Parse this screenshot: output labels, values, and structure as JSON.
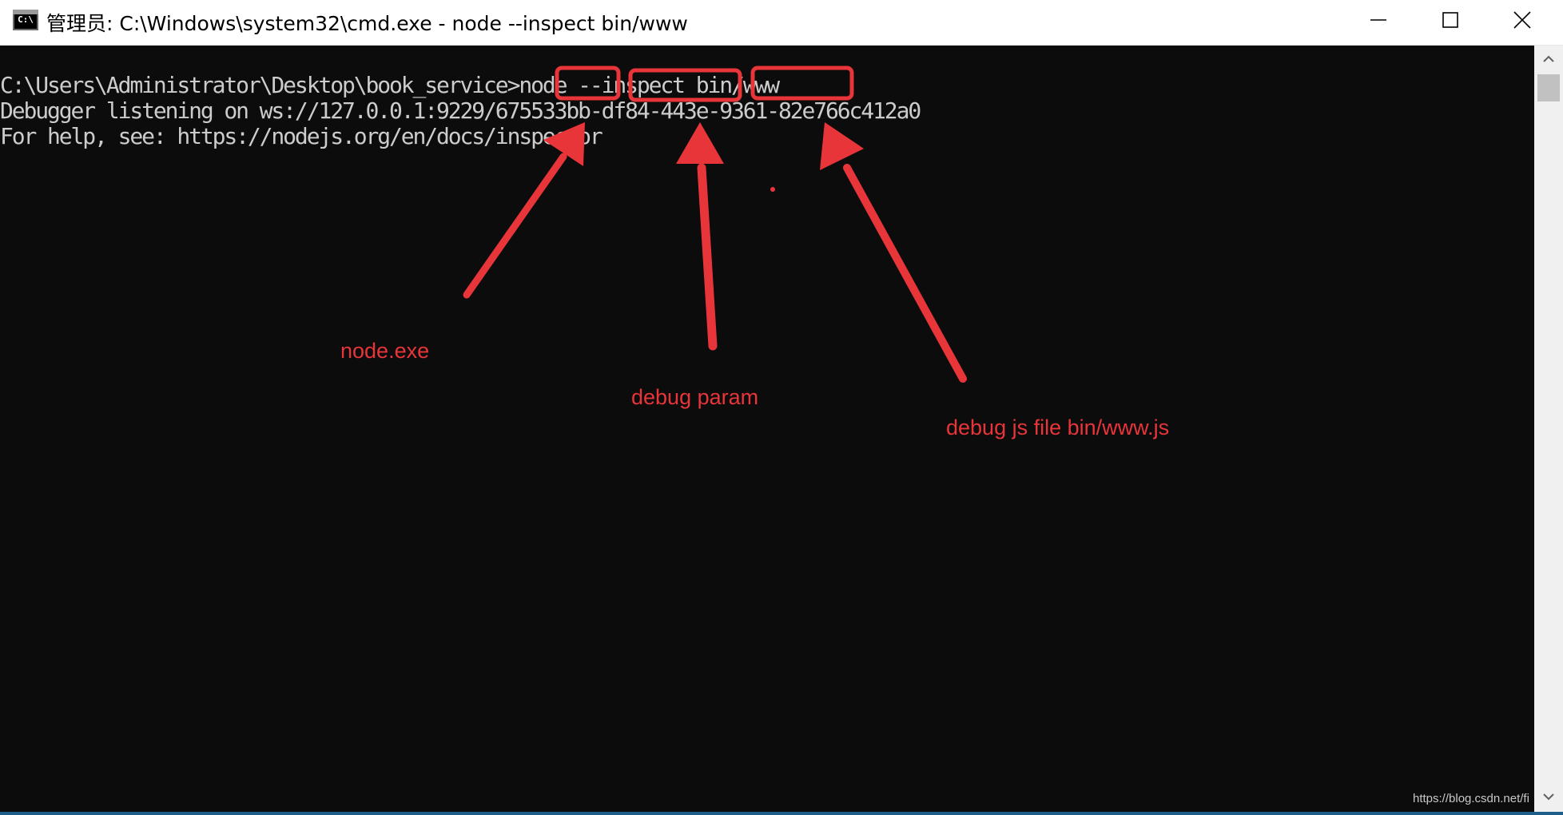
{
  "window": {
    "title": "管理员: C:\\Windows\\system32\\cmd.exe - node  --inspect bin/www",
    "icon": "cmd-icon",
    "icon_text": "C:\\",
    "controls": {
      "minimize": "minimize-icon",
      "maximize": "maximize-icon",
      "close": "close-icon"
    }
  },
  "terminal": {
    "lines": [
      "C:\\Users\\Administrator\\Desktop\\book_service>node --inspect bin/www",
      "Debugger listening on ws://127.0.0.1:9229/675533bb-df84-443e-9361-82e766c412a0",
      "For help, see: https://nodejs.org/en/docs/inspector"
    ],
    "background": "#0c0c0c",
    "foreground": "#cccccc"
  },
  "annotations": {
    "color": "#e8353a",
    "labels": [
      "node.exe",
      "debug param",
      "debug js file  bin/www.js"
    ],
    "highlighted_tokens": [
      "node",
      "--inspect",
      "bin/www"
    ]
  },
  "watermark": "https://blog.csdn.net/fi",
  "scrollbar": {
    "up": "scroll-up-arrow-icon",
    "down": "scroll-down-arrow-icon"
  }
}
